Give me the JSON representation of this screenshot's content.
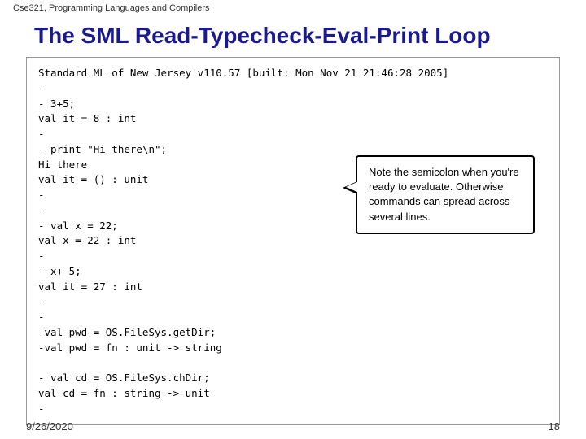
{
  "topbar": {
    "label": "Cse321, Programming Languages and Compilers"
  },
  "title": "The  SML Read-Typecheck-Eval-Print Loop",
  "code": {
    "content": "Standard ML of New Jersey v110.57 [built: Mon Nov 21 21:46:28 2005]\n-\n- 3+5;\nval it = 8 : int\n-\n- print \"Hi there\\n\";\nHi there\nval it = () : unit\n-\n-\n- val x = 22;\nval x = 22 : int\n-\n- x+ 5;\nval it = 27 : int\n-\n-\n-val pwd = OS.FileSys.getDir;\n-val pwd = fn : unit -> string\n\n- val cd = OS.FileSys.chDir;\nval cd = fn : string -> unit\n-"
  },
  "tooltip": {
    "text": "Note the semicolon when you're ready to evaluate. Otherwise commands can spread across several lines."
  },
  "footer": {
    "date": "9/26/2020",
    "page": "18"
  }
}
